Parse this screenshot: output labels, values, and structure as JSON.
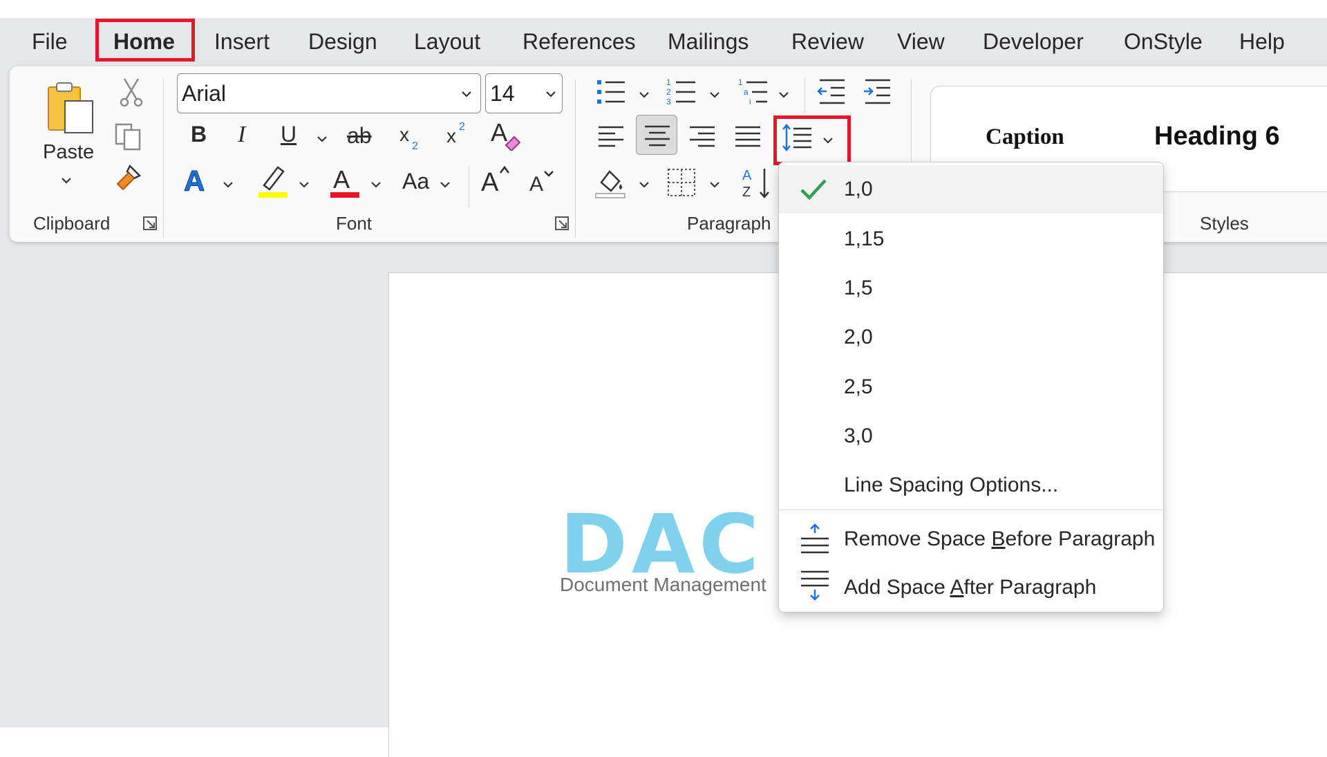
{
  "menu": {
    "items": [
      "File",
      "Home",
      "Insert",
      "Design",
      "Layout",
      "References",
      "Mailings",
      "Review",
      "View",
      "Developer",
      "OnStyle",
      "Help"
    ],
    "active": "Home"
  },
  "clipboard": {
    "paste_label": "Paste",
    "group_label": "Clipboard"
  },
  "font": {
    "name": "Arial",
    "size": "14",
    "group_label": "Font",
    "bold": "B",
    "italic": "I",
    "underline": "U",
    "strike": "ab",
    "change_case": "Aa",
    "grow": "A",
    "shrink": "A"
  },
  "paragraph": {
    "group_label": "Paragraph"
  },
  "styles": {
    "caption": "Caption",
    "heading6": "Heading 6",
    "group_label": "Styles"
  },
  "document": {
    "logo_text": "DAC",
    "logo_sub": "Document Management"
  },
  "line_spacing_menu": {
    "options": [
      "1,0",
      "1,15",
      "1,5",
      "2,0",
      "2,5",
      "3,0"
    ],
    "selected": "1,0",
    "options_label": "Line Spacing Options...",
    "remove_before": {
      "pre": "Remove Space ",
      "acc": "B",
      "post": "efore Paragraph"
    },
    "add_after": {
      "pre": "Add Space ",
      "acc": "A",
      "post": "fter Paragraph"
    }
  },
  "colors": {
    "highlight_box": "#e8142a",
    "check": "#2e9e4f",
    "logo": "#7fd1ee",
    "text_highlight": "#ffff00",
    "font_color": "#e8142a",
    "text_effects": "#1e74d6"
  },
  "icons": [
    "cut-icon",
    "copy-icon",
    "format-painter-icon",
    "clear-formatting-icon",
    "bullets-icon",
    "numbering-icon",
    "multilevel-list-icon",
    "decrease-indent-icon",
    "increase-indent-icon",
    "align-left-icon",
    "align-center-icon",
    "align-right-icon",
    "justify-icon",
    "line-spacing-icon",
    "shading-icon",
    "borders-icon",
    "sort-icon",
    "check-icon"
  ]
}
